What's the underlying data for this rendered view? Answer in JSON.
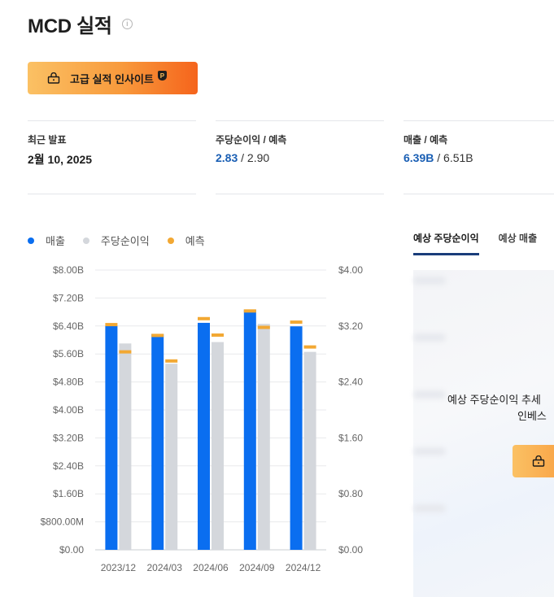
{
  "header": {
    "title": "MCD 실적",
    "info_glyph": "i"
  },
  "premium_button": {
    "label": "고급 실적 인사이트",
    "badge": "P"
  },
  "stats": [
    {
      "label": "최근 발표",
      "value": "2월 10, 2025"
    },
    {
      "label": "주당순이익 / 예측",
      "actual": "2.83",
      "separator": " / ",
      "forecast": "2.90"
    },
    {
      "label": "매출 / 예측",
      "actual": "6.39B",
      "separator": " / ",
      "forecast": "6.51B"
    }
  ],
  "legend": [
    {
      "label": "매출",
      "color": "#0a6ef0"
    },
    {
      "label": "주당순이익",
      "color": "#d4d7dc"
    },
    {
      "label": "예측",
      "color": "#f2a833"
    }
  ],
  "chart_data": {
    "type": "bar",
    "categories": [
      "2023/12",
      "2024/03",
      "2024/06",
      "2024/09",
      "2024/12"
    ],
    "y_left": {
      "ticks": [
        "$0.00",
        "$800.00M",
        "$1.60B",
        "$2.40B",
        "$3.20B",
        "$4.00B",
        "$4.80B",
        "$5.60B",
        "$6.40B",
        "$7.20B",
        "$8.00B"
      ],
      "ylim": [
        0,
        8.0
      ]
    },
    "y_right": {
      "ticks": [
        "$0.00",
        "$0.80",
        "$1.60",
        "$2.40",
        "$3.20",
        "$4.00"
      ],
      "ylim": [
        0,
        4.0
      ]
    },
    "series": [
      {
        "name": "매출",
        "axis": "left",
        "values": [
          6.41,
          6.17,
          6.49,
          6.87,
          6.39
        ],
        "color": "#0a6ef0"
      },
      {
        "name": "매출 예측",
        "axis": "left",
        "values": [
          6.44,
          6.13,
          6.61,
          6.83,
          6.51
        ],
        "color": "#f2a833"
      },
      {
        "name": "주당순이익",
        "axis": "right",
        "values": [
          2.95,
          2.66,
          2.97,
          3.23,
          2.83
        ],
        "color": "#d4d7dc"
      },
      {
        "name": "주당순이익 예측",
        "axis": "right",
        "values": [
          2.83,
          2.7,
          3.07,
          3.18,
          2.9
        ],
        "color": "#f2a833"
      }
    ],
    "grid": true
  },
  "right_panel": {
    "tabs": [
      {
        "label": "예상 주당순이익",
        "active": true
      },
      {
        "label": "예상 매출",
        "active": false
      }
    ],
    "locked_text_line1": "예상 주당순이익 추세",
    "locked_text_line2": "인베스"
  }
}
